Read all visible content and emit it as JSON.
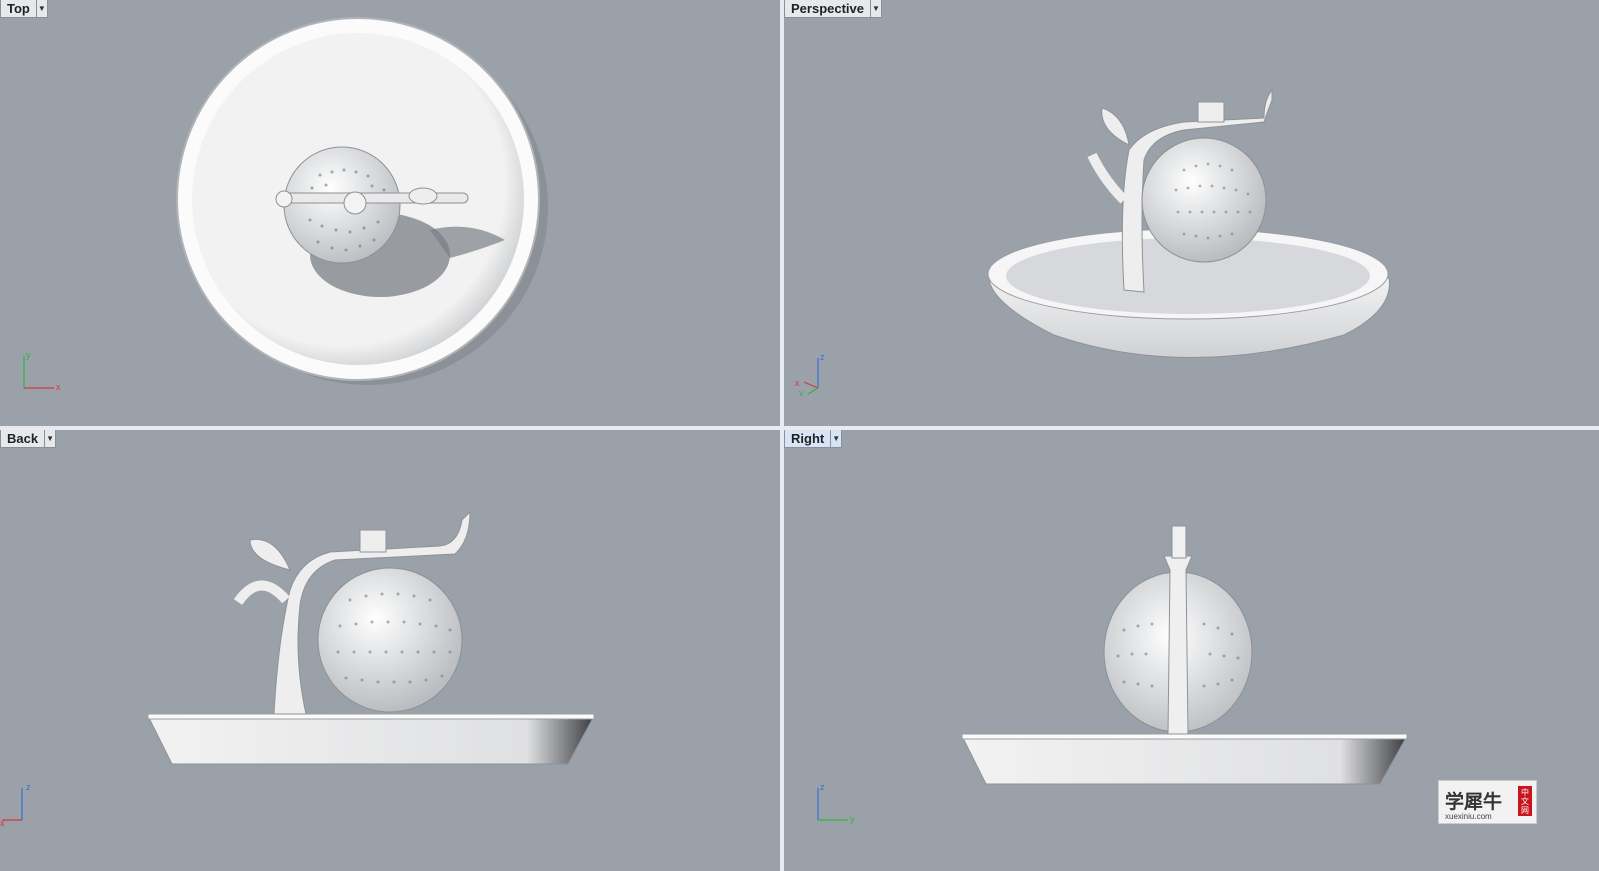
{
  "viewports": {
    "top": {
      "title": "Top",
      "axes": {
        "a": "y",
        "b": "x"
      }
    },
    "perspective": {
      "title": "Perspective",
      "axes": {
        "a": "z",
        "b": "x",
        "c": "y"
      }
    },
    "back": {
      "title": "Back",
      "axes": {
        "a": "z",
        "b": "x"
      }
    },
    "right": {
      "title": "Right",
      "axes": {
        "a": "z",
        "b": "y"
      }
    }
  },
  "watermark": {
    "chinese": "学犀牛",
    "badge_chars": [
      "中",
      "文",
      "网"
    ],
    "url": "xuexiniu.com"
  },
  "colors": {
    "background": "#9ba1a9",
    "model": "#f0f0f0",
    "active_title": "#d6e4f5",
    "axis_x": "#d23a3a",
    "axis_y": "#2fb24a",
    "axis_z": "#3a6fd8"
  },
  "icons": {
    "dropdown": "chevron-down-icon",
    "axis": "axis-gizmo-icon"
  }
}
